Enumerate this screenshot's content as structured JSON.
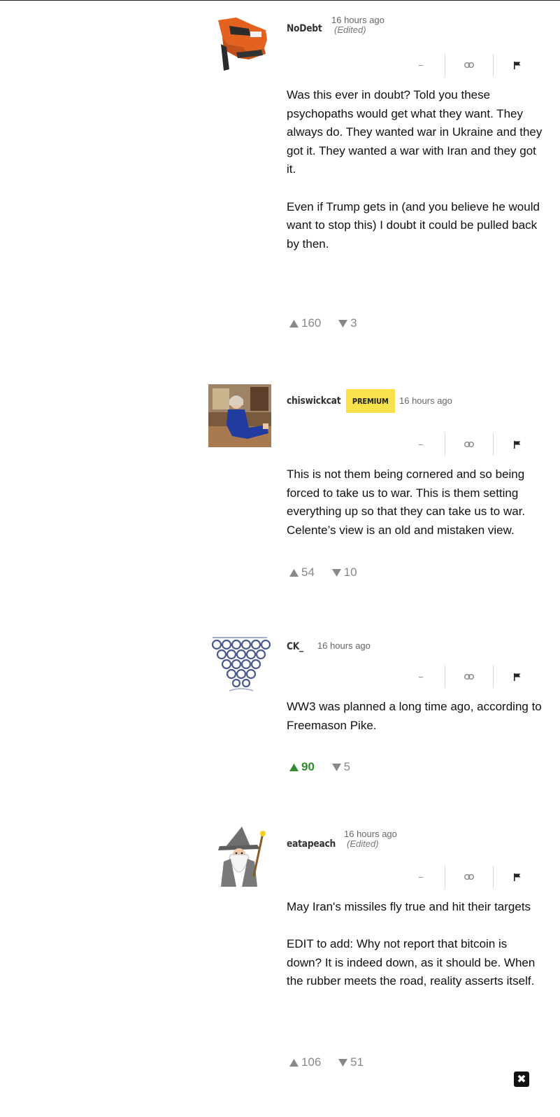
{
  "comments": [
    {
      "username": "NoDebt",
      "timestamp": "16 hours ago",
      "edited": "(Edited)",
      "premium": "",
      "avatar": "nail-gun-avatar",
      "paragraphs": [
        "Was this ever in doubt?  Told you these psychopaths would get what they want.  They always do.  They wanted war in Ukraine and they got it.  They wanted a war with Iran and they got it.",
        "Even if Trump gets in (and you believe he would want to stop this) I doubt it could be pulled back by then."
      ],
      "upvotes": "160",
      "downvotes": "3"
    },
    {
      "username": "chiswickcat",
      "timestamp": "16 hours ago",
      "edited": "",
      "premium": "PREMIUM",
      "avatar": "photo-avatar",
      "paragraphs": [
        "This is not them being cornered and so being forced to take us to war. This is them setting everything up so that they can take us to war. Celente’s view is an old and mistaken view."
      ],
      "upvotes": "54",
      "downvotes": "10"
    },
    {
      "username": "CK_",
      "timestamp": "16 hours ago",
      "edited": "",
      "premium": "",
      "avatar": "pyramid-avatar",
      "paragraphs": [
        "WW3 was planned a long time ago, according to Freemason Pike."
      ],
      "upvotes": "90",
      "downvotes": "5"
    },
    {
      "username": "eatapeach",
      "timestamp": "16 hours ago",
      "edited": "(Edited)",
      "premium": "",
      "avatar": "wizard-avatar",
      "paragraphs": [
        "May Iran's missiles fly true and hit their targets",
        "EDIT to add: Why not report that bitcoin is down? It is indeed down, as it should be. When the rubber meets the road, reality asserts itself."
      ],
      "upvotes": "106",
      "downvotes": "51"
    }
  ],
  "colors": {
    "active_vote": "#2e8b2e",
    "premium_badge": "#f7e24b",
    "muted_text": "#888888"
  },
  "icons": {
    "collapse": "minus-icon",
    "link": "link-icon",
    "report": "flag-icon",
    "upvote": "triangle-up-icon",
    "downvote": "triangle-down-icon",
    "close": "close-icon"
  }
}
